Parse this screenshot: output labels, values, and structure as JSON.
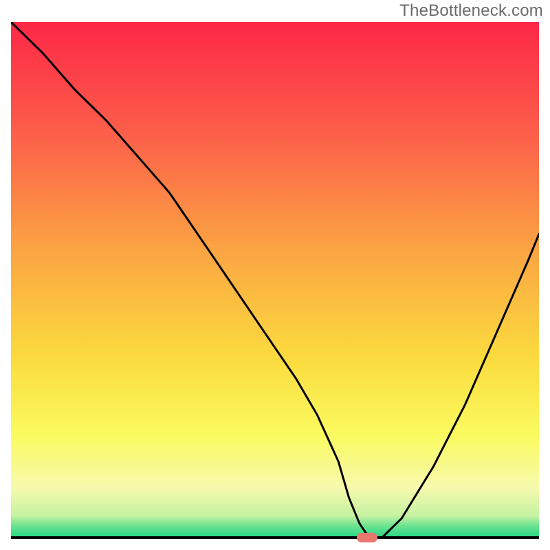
{
  "watermark": "TheBottleneck.com",
  "chart_data": {
    "type": "line",
    "title": "",
    "xlabel": "",
    "ylabel": "",
    "xlim": [
      0,
      100
    ],
    "ylim": [
      0,
      100
    ],
    "grid": false,
    "series": [
      {
        "name": "curve",
        "x": [
          0,
          6,
          12,
          18,
          24,
          30,
          36,
          42,
          48,
          54,
          58,
          62,
          64,
          66,
          68,
          70,
          74,
          80,
          86,
          92,
          98,
          100
        ],
        "y": [
          100,
          94,
          87,
          81,
          74,
          67,
          58,
          49,
          40,
          31,
          24,
          15,
          8,
          3,
          0,
          0,
          4,
          14,
          26,
          40,
          54,
          59
        ]
      }
    ],
    "annotations": [
      {
        "name": "min-marker",
        "x": 67.5,
        "y": 0,
        "shape": "pill",
        "color": "#e8776f"
      }
    ],
    "background_gradient": {
      "stops": [
        {
          "pos": 0.0,
          "color": "#fd2747"
        },
        {
          "pos": 0.22,
          "color": "#fc604a"
        },
        {
          "pos": 0.45,
          "color": "#fba742"
        },
        {
          "pos": 0.65,
          "color": "#fbdb3e"
        },
        {
          "pos": 0.8,
          "color": "#fafb60"
        },
        {
          "pos": 0.9,
          "color": "#f7faad"
        },
        {
          "pos": 0.955,
          "color": "#c6f2a2"
        },
        {
          "pos": 0.975,
          "color": "#6ae290"
        },
        {
          "pos": 1.0,
          "color": "#1cd582"
        }
      ]
    },
    "baseline": {
      "y": 0,
      "stroke": "#000000",
      "width": 4
    }
  }
}
